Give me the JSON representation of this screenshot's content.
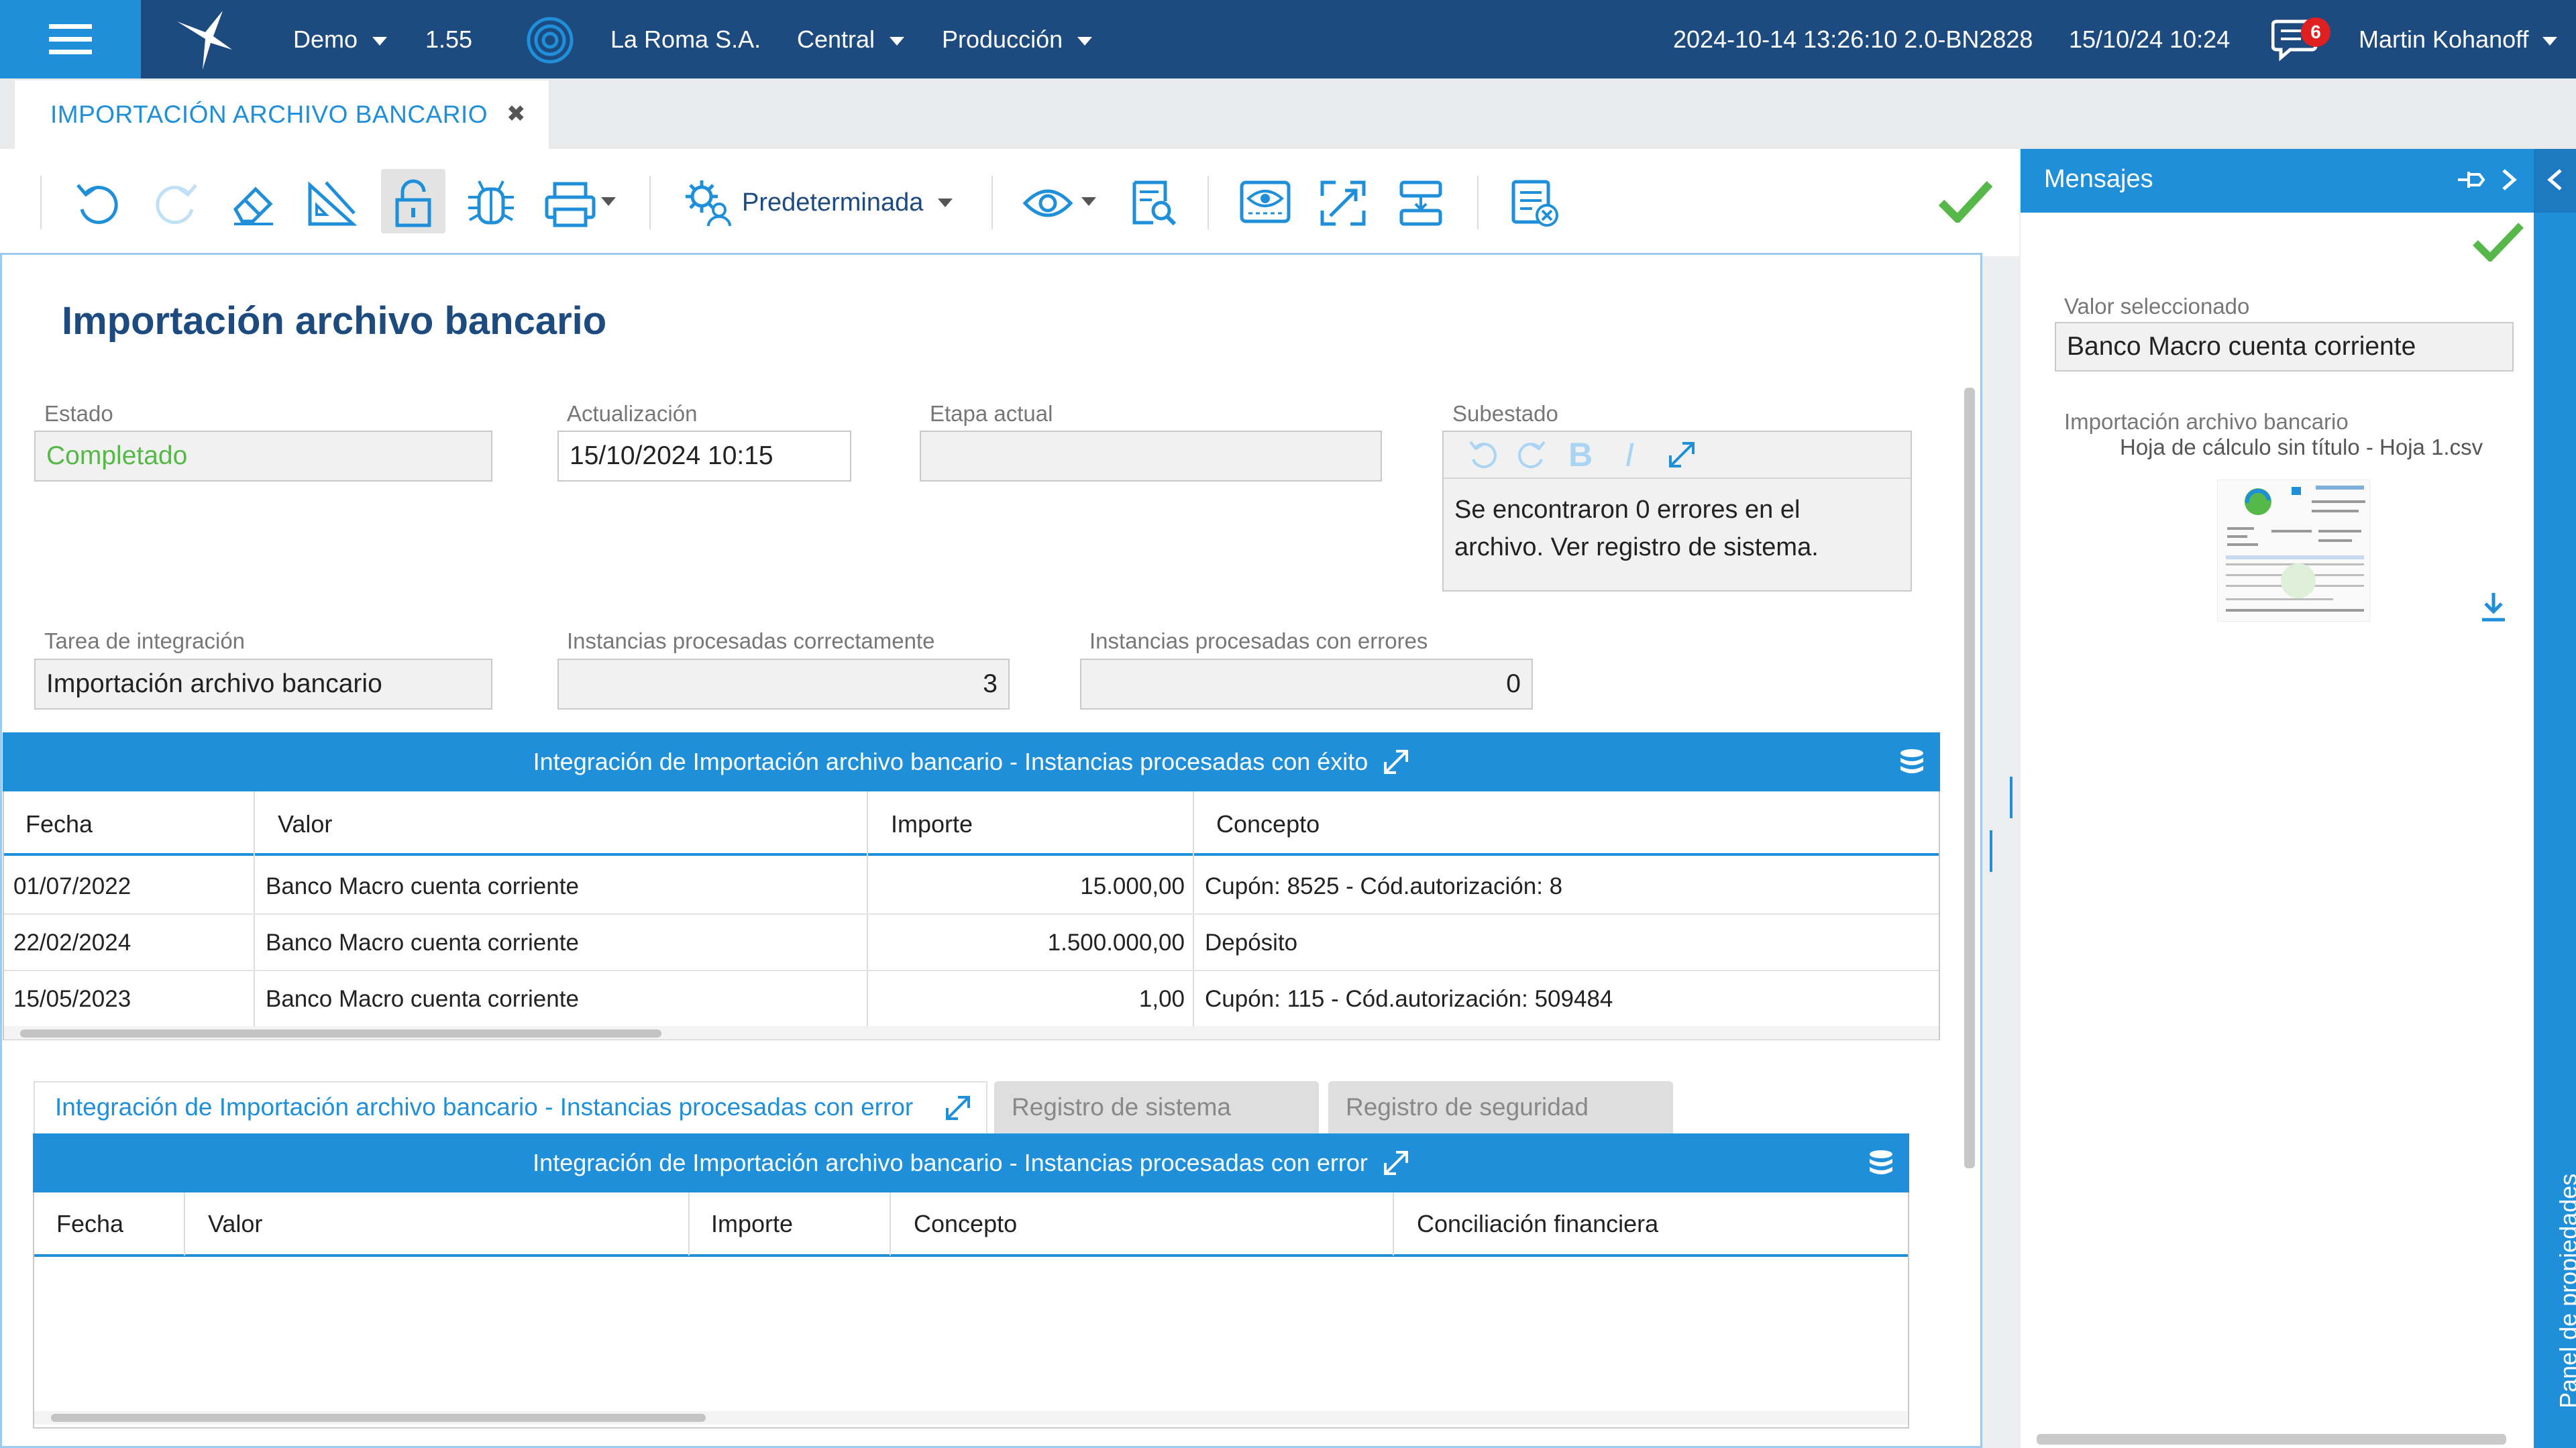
{
  "header": {
    "env": "Demo",
    "version": "1.55",
    "company": "La Roma S.A.",
    "branch": "Central",
    "mode": "Producción",
    "build": "2024-10-14 13:26:10 2.0-BN2828",
    "datetime": "15/10/24 10:24",
    "notifications": "6",
    "user": "Martin Kohanoff"
  },
  "tab": {
    "label": "IMPORTACIÓN ARCHIVO BANCARIO"
  },
  "toolbar": {
    "view_label": "Predeterminada"
  },
  "form": {
    "title": "Importación archivo bancario",
    "estado_label": "Estado",
    "estado_value": "Completado",
    "actualizacion_label": "Actualización",
    "actualizacion_value": "15/10/2024 10:15",
    "etapa_label": "Etapa actual",
    "etapa_value": "",
    "subestado_label": "Subestado",
    "subestado_line1": "Se encontraron 0 errores en el",
    "subestado_line2": "archivo. Ver registro de sistema.",
    "tarea_label": "Tarea de integración",
    "tarea_value": "Importación archivo bancario",
    "ok_label": "Instancias procesadas correctamente",
    "ok_value": "3",
    "err_label": "Instancias procesadas con errores",
    "err_value": "0"
  },
  "grid_success": {
    "title": "Integración de Importación archivo bancario - Instancias procesadas con éxito",
    "columns": [
      "Fecha",
      "Valor",
      "Importe",
      "Concepto"
    ],
    "rows": [
      [
        "01/07/2022",
        "Banco Macro cuenta corriente",
        "15.000,00",
        "Cupón: 8525 - Cód.autorización: 8"
      ],
      [
        "22/02/2024",
        "Banco Macro cuenta corriente",
        "1.500.000,00",
        "Depósito"
      ],
      [
        "15/05/2023",
        "Banco Macro cuenta corriente",
        "1,00",
        "Cupón: 115 - Cód.autorización: 509484"
      ]
    ]
  },
  "tabs_bottom": {
    "active": "Integración de Importación archivo bancario - Instancias procesadas con error",
    "system_log": "Registro de sistema",
    "security_log": "Registro de seguridad"
  },
  "grid_error": {
    "title": "Integración de Importación archivo bancario - Instancias procesadas con error",
    "columns": [
      "Fecha",
      "Valor",
      "Importe",
      "Concepto",
      "Conciliación financiera"
    ]
  },
  "messages": {
    "title": "Mensajes",
    "selected_label": "Valor seleccionado",
    "selected_value": "Banco Macro cuenta corriente",
    "file_title": "Importación archivo bancario",
    "file_name": "Hoja de cálculo sin título - Hoja 1.csv"
  },
  "side_panel": {
    "label": "Panel de propiedades"
  },
  "colors": {
    "primary": "#1e8fd8",
    "navy": "#1d4b80",
    "success": "#57b84a",
    "badge": "#e02020"
  }
}
